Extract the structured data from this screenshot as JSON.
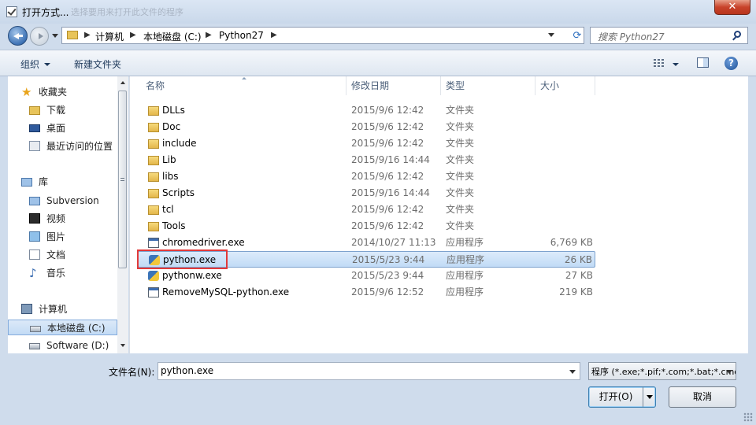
{
  "window": {
    "title": "打开方式...",
    "ghost_title": "选择要用来打开此文件的程序",
    "close_label": "✕"
  },
  "address": {
    "crumbs": [
      "计算机",
      "本地磁盘 (C:)",
      "Python27"
    ],
    "search_placeholder": "搜索 Python27"
  },
  "toolbar": {
    "organize_label": "组织",
    "new_folder_label": "新建文件夹",
    "help_label": "?"
  },
  "navigation": {
    "favorites_label": "收藏夹",
    "favorites": [
      {
        "label": "下载",
        "icon": "download-folder-icon"
      },
      {
        "label": "桌面",
        "icon": "desktop-icon"
      },
      {
        "label": "最近访问的位置",
        "icon": "recent-places-icon"
      }
    ],
    "libraries_label": "库",
    "libraries": [
      {
        "label": "Subversion",
        "icon": "library-icon"
      },
      {
        "label": "视频",
        "icon": "video-icon"
      },
      {
        "label": "图片",
        "icon": "picture-icon"
      },
      {
        "label": "文档",
        "icon": "document-icon"
      },
      {
        "label": "音乐",
        "icon": "music-icon"
      }
    ],
    "computer_label": "计算机",
    "drives": [
      {
        "label": "本地磁盘 (C:)",
        "selected": true
      },
      {
        "label": "Software (D:)",
        "selected": false
      }
    ]
  },
  "file_list": {
    "columns": {
      "name": "名称",
      "date": "修改日期",
      "type": "类型",
      "size": "大小"
    },
    "rows": [
      {
        "name": "DLLs",
        "date": "2015/9/6 12:42",
        "type": "文件夹",
        "size": "",
        "icon": "folder"
      },
      {
        "name": "Doc",
        "date": "2015/9/6 12:42",
        "type": "文件夹",
        "size": "",
        "icon": "folder"
      },
      {
        "name": "include",
        "date": "2015/9/6 12:42",
        "type": "文件夹",
        "size": "",
        "icon": "folder"
      },
      {
        "name": "Lib",
        "date": "2015/9/16 14:44",
        "type": "文件夹",
        "size": "",
        "icon": "folder"
      },
      {
        "name": "libs",
        "date": "2015/9/6 12:42",
        "type": "文件夹",
        "size": "",
        "icon": "folder"
      },
      {
        "name": "Scripts",
        "date": "2015/9/16 14:44",
        "type": "文件夹",
        "size": "",
        "icon": "folder"
      },
      {
        "name": "tcl",
        "date": "2015/9/6 12:42",
        "type": "文件夹",
        "size": "",
        "icon": "folder"
      },
      {
        "name": "Tools",
        "date": "2015/9/6 12:42",
        "type": "文件夹",
        "size": "",
        "icon": "folder"
      },
      {
        "name": "chromedriver.exe",
        "date": "2014/10/27 11:13",
        "type": "应用程序",
        "size": "6,769 KB",
        "icon": "exe"
      },
      {
        "name": "python.exe",
        "date": "2015/5/23 9:44",
        "type": "应用程序",
        "size": "26 KB",
        "icon": "python",
        "selected": true
      },
      {
        "name": "pythonw.exe",
        "date": "2015/5/23 9:44",
        "type": "应用程序",
        "size": "27 KB",
        "icon": "python"
      },
      {
        "name": "RemoveMySQL-python.exe",
        "date": "2015/9/6 12:52",
        "type": "应用程序",
        "size": "219 KB",
        "icon": "exe"
      }
    ]
  },
  "bottom": {
    "filename_label": "文件名(N):",
    "filename_value": "python.exe",
    "filter_value": "程序 (*.exe;*.pif;*.com;*.bat;*.cmd)",
    "open_label": "打开(O)",
    "cancel_label": "取消"
  },
  "colors": {
    "selection": "#cce4f8",
    "highlight_box": "#e23a3a",
    "accent": "#3d72b5"
  }
}
